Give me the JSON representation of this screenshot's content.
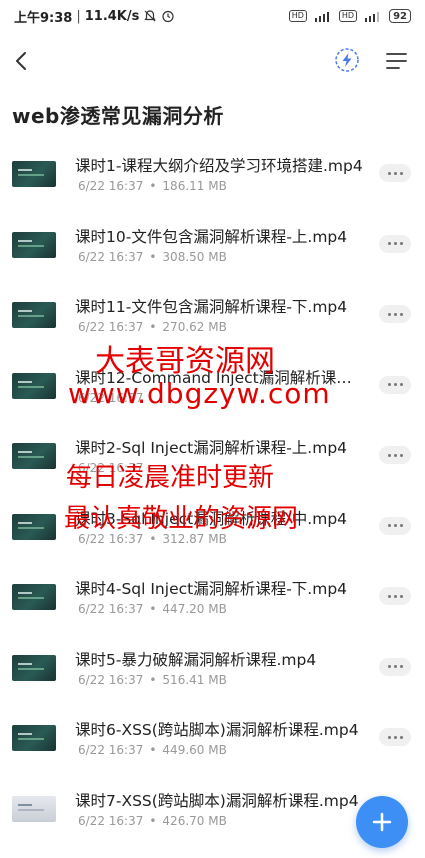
{
  "status_bar": {
    "time": "上午9:38",
    "speed": "11.4K/s",
    "battery": "92",
    "icons": [
      "mute-icon",
      "alarm-icon",
      "hd-icon",
      "signal-4g-icon",
      "hd-icon",
      "signal-4g-icon",
      "battery-icon"
    ]
  },
  "header": {
    "back_icon": "chevron-left-icon",
    "flash_icon": "flash-icon",
    "menu_icon": "menu-icon"
  },
  "page": {
    "title": "web渗透常见漏洞分析"
  },
  "files": [
    {
      "name": "课时1-课程大纲介绍及学习环境搭建.mp4",
      "date": "6/22 16:37",
      "size": "186.11 MB",
      "thumb": "dark"
    },
    {
      "name": "课时10-文件包含漏洞解析课程-上.mp4",
      "date": "6/22 16:37",
      "size": "308.50 MB",
      "thumb": "dark"
    },
    {
      "name": "课时11-文件包含漏洞解析课程-下.mp4",
      "date": "6/22 16:37",
      "size": "270.62 MB",
      "thumb": "dark"
    },
    {
      "name": "课时12-Command Inject漏洞解析课程.mp4",
      "date": "6/22 16:37",
      "size": "",
      "thumb": "dark"
    },
    {
      "name": "课时2-Sql Inject漏洞解析课程-上.mp4",
      "date": "6/22 16:37",
      "size": "",
      "thumb": "dark"
    },
    {
      "name": "课时3-Sql Inject漏洞解析课程-中.mp4",
      "date": "6/22 16:37",
      "size": "312.87 MB",
      "thumb": "dark"
    },
    {
      "name": "课时4-Sql Inject漏洞解析课程-下.mp4",
      "date": "6/22 16:37",
      "size": "447.20 MB",
      "thumb": "dark"
    },
    {
      "name": "课时5-暴力破解漏洞解析课程.mp4",
      "date": "6/22 16:37",
      "size": "516.41 MB",
      "thumb": "dark"
    },
    {
      "name": "课时6-XSS(跨站脚本)漏洞解析课程.mp4",
      "date": "6/22 16:37",
      "size": "449.60 MB",
      "thumb": "dark"
    },
    {
      "name": "课时7-XSS(跨站脚本)漏洞解析课程.mp4",
      "date": "6/22 16:37",
      "size": "426.70 MB",
      "thumb": "light"
    }
  ],
  "watermark": {
    "line1": "大表哥资源网",
    "line2": "www.dbgzyw.com",
    "line3": "每日凌晨准时更新",
    "line4": "最认真敬业的资源网"
  },
  "fab": {
    "icon": "plus-icon"
  },
  "colors": {
    "accent": "#3d8ff5",
    "watermark": "#e30000",
    "meta_text": "#999999"
  }
}
